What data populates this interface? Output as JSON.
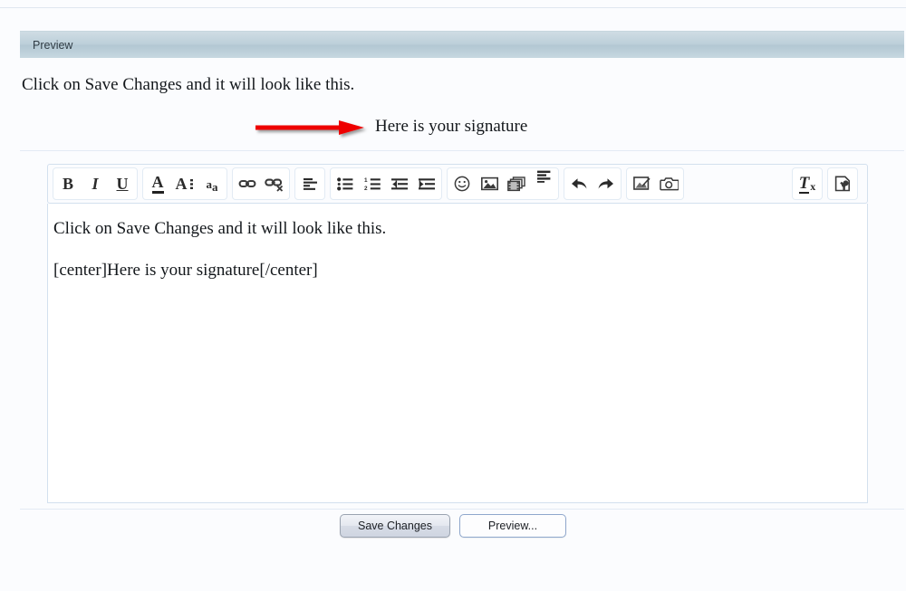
{
  "preview": {
    "header_title": "Preview",
    "line1": "Click on Save Changes and it will look like this.",
    "signature_text": "Here is your signature",
    "annotation_arrow": "red-arrow-icon",
    "arrow_color": "#ee0000"
  },
  "editor": {
    "toolbar_groups": [
      {
        "name": "formatting",
        "buttons": [
          {
            "name": "bold-icon",
            "label": "B",
            "title": "Bold"
          },
          {
            "name": "italic-icon",
            "label": "I",
            "title": "Italic"
          },
          {
            "name": "underline-icon",
            "label": "U",
            "title": "Underline"
          }
        ]
      },
      {
        "name": "font",
        "buttons": [
          {
            "name": "font-color-icon",
            "label": "A",
            "title": "Font Colour"
          },
          {
            "name": "font-size-icon",
            "label": "A",
            "title": "Font Size"
          },
          {
            "name": "text-case-icon",
            "label": "a",
            "title": "Change Case"
          }
        ]
      },
      {
        "name": "links",
        "buttons": [
          {
            "name": "insert-link-icon",
            "label": "",
            "title": "Insert Link"
          },
          {
            "name": "remove-link-icon",
            "label": "",
            "title": "Remove Link"
          }
        ]
      },
      {
        "name": "alignment",
        "buttons": [
          {
            "name": "align-left-icon",
            "label": "",
            "title": "Align"
          }
        ]
      },
      {
        "name": "lists",
        "buttons": [
          {
            "name": "bullet-list-icon",
            "label": "",
            "title": "Bulleted List"
          },
          {
            "name": "numbered-list-icon",
            "label": "",
            "title": "Numbered List"
          },
          {
            "name": "outdent-icon",
            "label": "",
            "title": "Decrease Indent"
          },
          {
            "name": "indent-icon",
            "label": "",
            "title": "Increase Indent"
          }
        ]
      },
      {
        "name": "media",
        "buttons": [
          {
            "name": "emoji-icon",
            "label": "",
            "title": "Insert Smilie"
          },
          {
            "name": "insert-image-icon",
            "label": "",
            "title": "Insert Image"
          },
          {
            "name": "insert-video-icon",
            "label": "",
            "title": "Insert Video"
          },
          {
            "name": "insert-quote-icon",
            "label": "",
            "title": "Insert Quote"
          }
        ]
      },
      {
        "name": "history",
        "buttons": [
          {
            "name": "undo-icon",
            "label": "",
            "title": "Undo"
          },
          {
            "name": "redo-icon",
            "label": "",
            "title": "Redo"
          }
        ]
      },
      {
        "name": "attachments",
        "buttons": [
          {
            "name": "edit-image-icon",
            "label": "",
            "title": "Edit Image"
          },
          {
            "name": "camera-icon",
            "label": "",
            "title": "Take Photo"
          }
        ]
      },
      {
        "name": "remove-format",
        "buttons": [
          {
            "name": "remove-format-icon",
            "label": "T",
            "title": "Remove Formatting"
          }
        ]
      },
      {
        "name": "source",
        "buttons": [
          {
            "name": "source-tools-icon",
            "label": "",
            "title": "Source / Tools"
          }
        ]
      }
    ],
    "content_paragraphs": [
      "Click on Save Changes and it will look like this.",
      "[center]Here is your signature[/center]"
    ]
  },
  "footer": {
    "save_label": "Save Changes",
    "preview_label": "Preview..."
  }
}
